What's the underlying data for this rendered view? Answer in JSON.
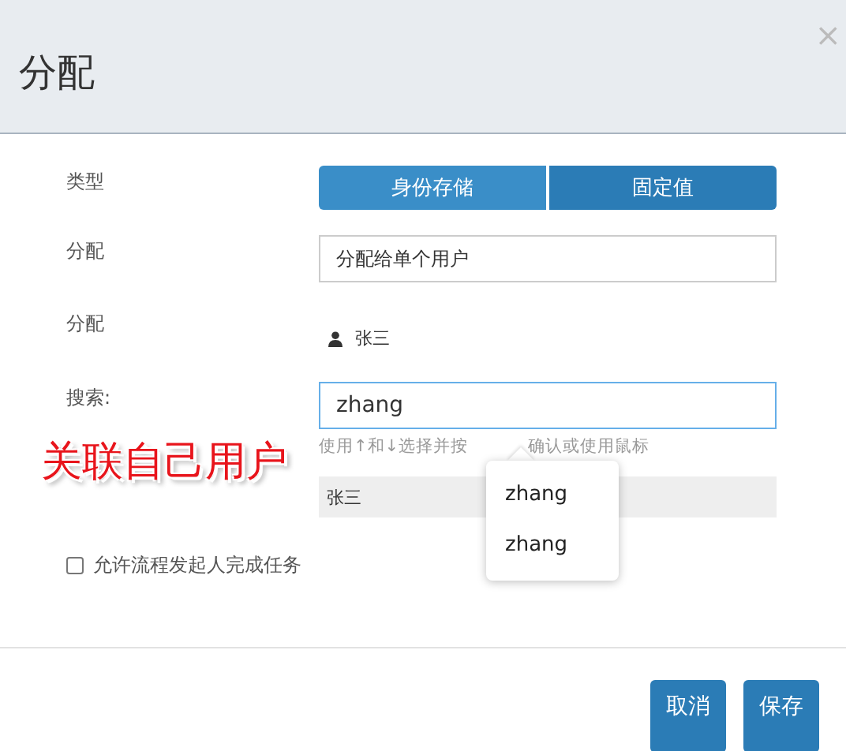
{
  "dialog": {
    "title": "分配",
    "close": "×"
  },
  "type_row": {
    "label": "类型",
    "options": [
      {
        "label": "身份存储",
        "selected": false
      },
      {
        "label": "固定值",
        "selected": true
      }
    ]
  },
  "assign_row": {
    "label": "分配",
    "value": "分配给单个用户"
  },
  "assignee_row": {
    "label": "分配",
    "user": "张三"
  },
  "search_row": {
    "label": "搜索:",
    "value": "zhang",
    "hint_parts": [
      "使用↑和↓选择并按",
      "确认或使用鼠标"
    ],
    "results": [
      {
        "name": "张三"
      }
    ]
  },
  "autocomplete": {
    "items": [
      "zhang",
      "zhang"
    ]
  },
  "annotation": "关联自己用户",
  "allow_initiator": {
    "label": "允许流程发起人完成任务",
    "checked": false
  },
  "buttons": [
    {
      "label": "取消"
    },
    {
      "label": "保存"
    }
  ]
}
